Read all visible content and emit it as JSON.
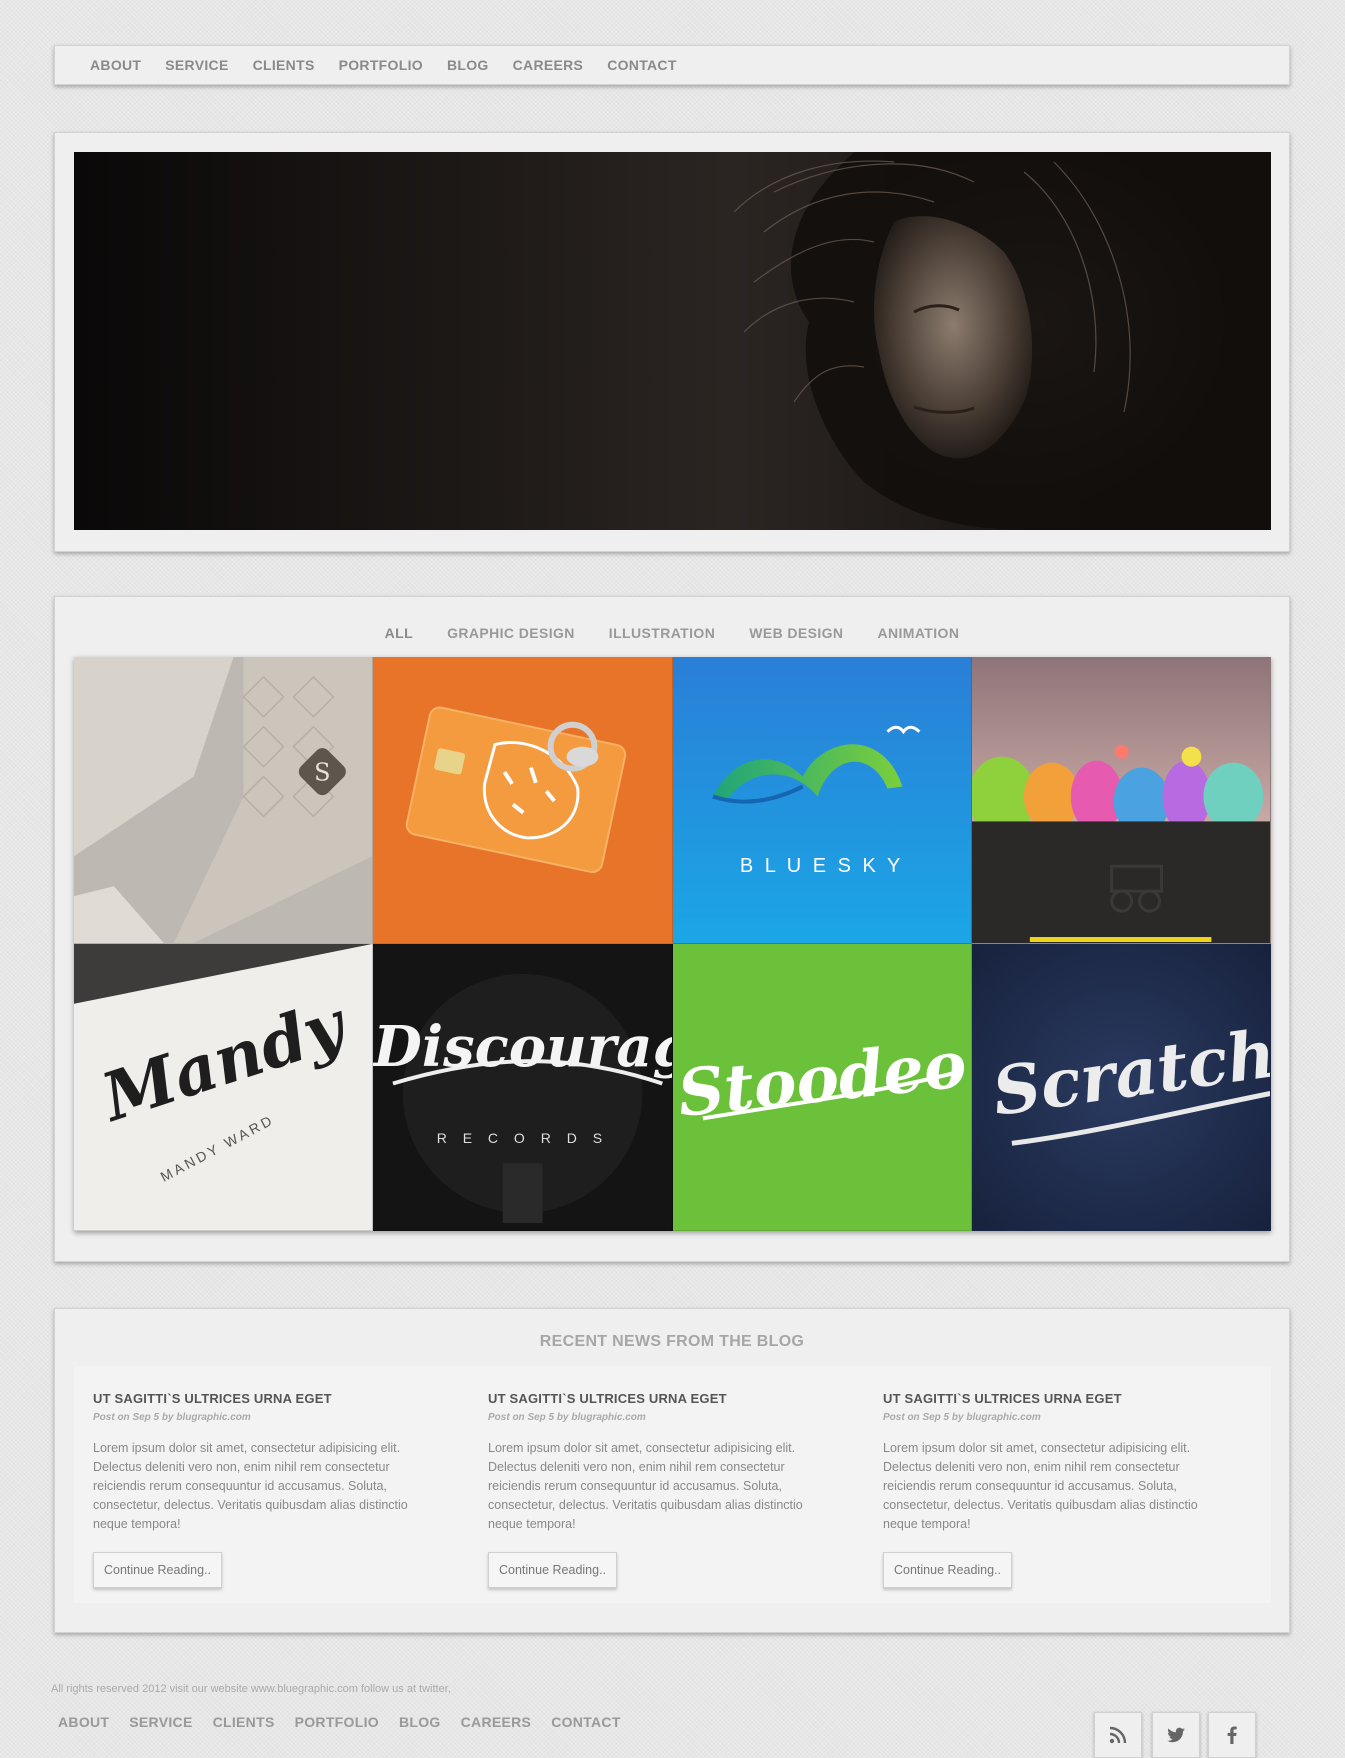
{
  "nav": {
    "items": [
      "ABOUT",
      "SERVICE",
      "CLIENTS",
      "PORTFOLIO",
      "BLOG",
      "CAREERS",
      "CONTACT"
    ]
  },
  "portfolio": {
    "filters": [
      "ALL",
      "GRAPHIC DESIGN",
      "ILLUSTRATION",
      "WEB DESIGN",
      "ANIMATION"
    ],
    "tiles": {
      "blue_sky": "B L U E   S K Y",
      "mandy": "Mandy",
      "mandy_sub": "MANDY WARD",
      "discourage": "Discourage",
      "discourage_sub": "R E C O R D S",
      "stoodeo": "Stoodeo",
      "scratch": "Scratch"
    },
    "colors": {
      "orange": "#e8742a",
      "blue": "#1f8fd8",
      "green": "#6cc13a",
      "navy": "#1d2b4d",
      "highlight": "#f0d21a"
    }
  },
  "blog": {
    "heading": "RECENT NEWS FROM THE BLOG",
    "posts": [
      {
        "title": "UT SAGITTI`S ULTRICES URNA EGET",
        "meta": "Post on Sep 5 by blugraphic.com",
        "body": "Lorem ipsum dolor sit amet, consectetur adipisicing elit. Delectus deleniti vero non, enim nihil rem consectetur reiciendis rerum consequuntur id accusamus. Soluta, consectetur, delectus. Veritatis quibusdam alias distinctio neque tempora!",
        "button": "Continue Reading.."
      },
      {
        "title": "UT SAGITTI`S ULTRICES URNA EGET",
        "meta": "Post on Sep 5 by blugraphic.com",
        "body": "Lorem ipsum dolor sit amet, consectetur adipisicing elit. Delectus deleniti vero non, enim nihil rem consectetur reiciendis rerum consequuntur id accusamus. Soluta, consectetur, delectus. Veritatis quibusdam alias distinctio neque tempora!",
        "button": "Continue Reading.."
      },
      {
        "title": "UT SAGITTI`S ULTRICES URNA EGET",
        "meta": "Post on Sep 5 by blugraphic.com",
        "body": "Lorem ipsum dolor sit amet, consectetur adipisicing elit. Delectus deleniti vero non, enim nihil rem consectetur reiciendis rerum consequuntur id accusamus. Soluta, consectetur, delectus. Veritatis quibusdam alias distinctio neque tempora!",
        "button": "Continue Reading.."
      }
    ]
  },
  "footer": {
    "copyright": "All rights reserved 2012 visit our website www.bluegraphic.com follow us at twitter,",
    "nav": [
      "ABOUT",
      "SERVICE",
      "CLIENTS",
      "PORTFOLIO",
      "BLOG",
      "CAREERS",
      "CONTACT"
    ],
    "social_icons": [
      "rss-icon",
      "twitter-icon",
      "facebook-icon"
    ]
  }
}
